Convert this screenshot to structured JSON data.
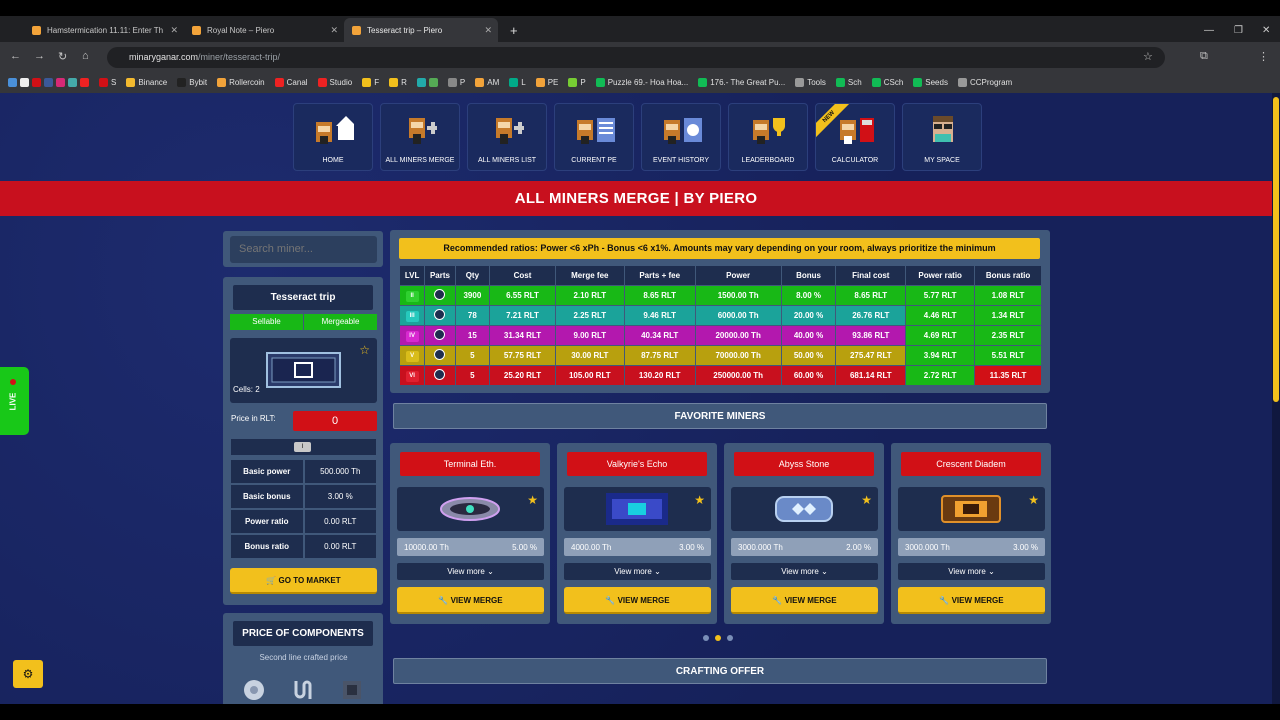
{
  "browser": {
    "tabs": [
      {
        "title": "Hamstermication 11.11: Enter Th"
      },
      {
        "title": "Royal Note – Piero"
      },
      {
        "title": "Tesseract trip – Piero"
      }
    ],
    "url_host": "minaryganar.com",
    "url_path": "/miner/tesseract-trip/",
    "bookmarks": [
      "S",
      "Binance",
      "Bybit",
      "Rollercoin",
      "Canal",
      "Studio",
      "F",
      "R",
      "P",
      "AM",
      "L",
      "PE",
      "P",
      "Puzzle 69.- Hoa Hoa...",
      "176.- The Great Pu...",
      "Tools",
      "Sch",
      "CSch",
      "Seeds",
      "CCProgram"
    ]
  },
  "nav": [
    {
      "label": "HOME"
    },
    {
      "label": "ALL MINERS MERGE"
    },
    {
      "label": "ALL MINERS LIST"
    },
    {
      "label": "CURRENT PE"
    },
    {
      "label": "EVENT HISTORY"
    },
    {
      "label": "LEADERBOARD"
    },
    {
      "label": "CALCULATOR",
      "badge": "NEW"
    },
    {
      "label": "MY SPACE"
    }
  ],
  "banner": "ALL MINERS MERGE | BY PIERO",
  "sidebar": {
    "search_placeholder": "Search miner...",
    "miner_name": "Tesseract trip",
    "tag_sellable": "Sellable",
    "tag_mergeable": "Mergeable",
    "cells": "Cells: 2",
    "price_label": "Price in RLT:",
    "price_value": "0",
    "slider_value": "I",
    "stats": [
      {
        "label": "Basic power",
        "value": "500.000 Th"
      },
      {
        "label": "Basic bonus",
        "value": "3.00 %"
      },
      {
        "label": "Power ratio",
        "value": "0.00 RLT"
      },
      {
        "label": "Bonus ratio",
        "value": "0.00 RLT"
      }
    ],
    "market_button": "GO TO MARKET",
    "components_title": "PRICE OF COMPONENTS",
    "components_sub": "Second line crafted price"
  },
  "recommendation": "Recommended ratios: Power <6 xPh - Bonus <6 x1%. Amounts may vary depending on your room, always prioritize the minimum",
  "merge_table": {
    "headers": [
      "LVL",
      "Parts",
      "Qty",
      "Cost",
      "Merge fee",
      "Parts + fee",
      "Power",
      "Bonus",
      "Final cost",
      "Power ratio",
      "Bonus ratio"
    ],
    "rows": [
      {
        "lvl": "II",
        "qty": "3900",
        "cost": "6.55 RLT",
        "fee": "2.10 RLT",
        "parts_fee": "8.65 RLT",
        "power": "1500.00 Th",
        "bonus": "8.00 %",
        "final": "8.65 RLT",
        "pratio": "5.77 RLT",
        "bratio": "1.08 RLT",
        "color": "#18b816",
        "lvcolor": "#2fd02f",
        "pcolor": "#18b816",
        "bcolor": "#18b816"
      },
      {
        "lvl": "III",
        "qty": "78",
        "cost": "7.21 RLT",
        "fee": "2.25 RLT",
        "parts_fee": "9.46 RLT",
        "power": "6000.00 Th",
        "bonus": "20.00 %",
        "final": "26.76 RLT",
        "pratio": "4.46 RLT",
        "bratio": "1.34 RLT",
        "color": "#1ba39a",
        "lvcolor": "#26c9bd",
        "pcolor": "#18b816",
        "bcolor": "#18b816"
      },
      {
        "lvl": "IV",
        "qty": "15",
        "cost": "31.34 RLT",
        "fee": "9.00 RLT",
        "parts_fee": "40.34 RLT",
        "power": "20000.00 Th",
        "bonus": "40.00 %",
        "final": "93.86 RLT",
        "pratio": "4.69 RLT",
        "bratio": "2.35 RLT",
        "color": "#b318ae",
        "lvcolor": "#d828d0",
        "pcolor": "#18b816",
        "bcolor": "#18b816"
      },
      {
        "lvl": "V",
        "qty": "5",
        "cost": "57.75 RLT",
        "fee": "30.00 RLT",
        "parts_fee": "87.75 RLT",
        "power": "70000.00 Th",
        "bonus": "50.00 %",
        "final": "275.47 RLT",
        "pratio": "3.94 RLT",
        "bratio": "5.51 RLT",
        "color": "#b8a00e",
        "lvcolor": "#d9bd1a",
        "pcolor": "#18b816",
        "bcolor": "#18b816"
      },
      {
        "lvl": "VI",
        "qty": "5",
        "cost": "25.20 RLT",
        "fee": "105.00 RLT",
        "parts_fee": "130.20 RLT",
        "power": "250000.00 Th",
        "bonus": "60.00 %",
        "final": "681.14 RLT",
        "pratio": "2.72 RLT",
        "bratio": "11.35 RLT",
        "color": "#c8101e",
        "lvcolor": "#e02030",
        "pcolor": "#18b816",
        "bcolor": "#d11016"
      }
    ]
  },
  "favorites_title": "FAVORITE MINERS",
  "favorites": [
    {
      "name": "Terminal Eth.",
      "power": "10000.00 Th",
      "bonus": "5.00 %",
      "more": "View more",
      "action": "VIEW MERGE"
    },
    {
      "name": "Valkyrie's Echo",
      "power": "4000.00 Th",
      "bonus": "3.00 %",
      "more": "View more",
      "action": "VIEW MERGE"
    },
    {
      "name": "Abyss Stone",
      "power": "3000.000 Th",
      "bonus": "2.00 %",
      "more": "View more",
      "action": "VIEW MERGE"
    },
    {
      "name": "Crescent Diadem",
      "power": "3000.000 Th",
      "bonus": "3.00 %",
      "more": "View more",
      "action": "VIEW MERGE"
    }
  ],
  "crafting_title": "CRAFTING OFFER",
  "live_label": "LIVE",
  "colors": {
    "accent": "#f2c01c",
    "banner": "#c8101e",
    "bg": "#16215a",
    "panel": "#40587a"
  }
}
